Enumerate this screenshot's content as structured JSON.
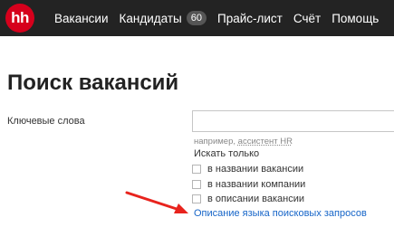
{
  "header": {
    "logo_text": "hh",
    "logo_color": "#d6001c",
    "nav": [
      {
        "label": "Вакансии"
      },
      {
        "label": "Кандидаты",
        "badge": "60"
      },
      {
        "label": "Прайс-лист"
      },
      {
        "label": "Счёт"
      },
      {
        "label": "Помощь"
      }
    ]
  },
  "main": {
    "title": "Поиск вакансий",
    "keywords_label": "Ключевые слова",
    "keywords_value": "",
    "hint_prefix": "например,",
    "hint_example": "ассистент HR",
    "search_only_label": "Искать только",
    "checkboxes": [
      {
        "label": "в названии вакансии",
        "checked": false
      },
      {
        "label": "в названии компании",
        "checked": false
      },
      {
        "label": "в описании вакансии",
        "checked": false
      }
    ],
    "help_link": "Описание языка поисковых запросов"
  },
  "annotation": {
    "arrow_color": "#e8231d"
  }
}
